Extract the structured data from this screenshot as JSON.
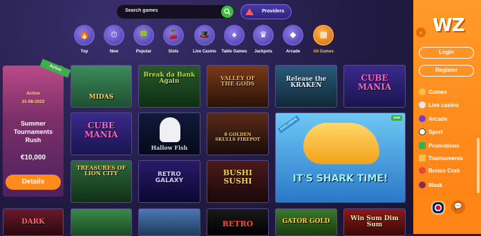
{
  "search": {
    "placeholder": "Search games"
  },
  "providers": {
    "label": "Providers"
  },
  "categories": [
    {
      "label": "Top",
      "icon": "flame-icon"
    },
    {
      "label": "New",
      "icon": "new-icon"
    },
    {
      "label": "Popular",
      "icon": "clover-icon"
    },
    {
      "label": "Slots",
      "icon": "cherry-icon"
    },
    {
      "label": "Live Casino",
      "icon": "dealer-icon"
    },
    {
      "label": "Table Games",
      "icon": "cards-icon"
    },
    {
      "label": "Jackpots",
      "icon": "crown-icon"
    },
    {
      "label": "Arcade",
      "icon": "gem-icon"
    },
    {
      "label": "All Games",
      "icon": "grid-icon"
    }
  ],
  "promo": {
    "ribbon": "Active",
    "status": "Active",
    "date": "31-08-2022",
    "title": "Summer Tournaments Rush",
    "prize": "€10,000",
    "button": "Details"
  },
  "games": [
    {
      "title": "MIDAS"
    },
    {
      "title": "Break da Bank Again"
    },
    {
      "title": "VALLEY OF THE GODS"
    },
    {
      "title": "Release the KRAKEN"
    },
    {
      "title": "CUBE MANIA"
    },
    {
      "title": "CUBE MANIA"
    },
    {
      "title": "Hallow Fish"
    },
    {
      "title": "8 GOLDEN SKULLS FIREPOT"
    },
    {
      "title": "TREASURES OF LION CITY"
    },
    {
      "title": "RETRO GALAXY"
    },
    {
      "title": "BUSHI SUSHI"
    },
    {
      "title": "IT'S SHARK TIME!"
    },
    {
      "title": "DARK"
    },
    {
      "title": ""
    },
    {
      "title": ""
    },
    {
      "title": "RETRO"
    },
    {
      "title": "GATOR GOLD"
    },
    {
      "title": "Win Sum Dim Sum"
    }
  ],
  "badges": {
    "new": "new",
    "exclusive": "EXCLUSIVE"
  },
  "panel": {
    "logo": "WZ",
    "login": "Login",
    "register": "Register",
    "menu": [
      {
        "label": "Games"
      },
      {
        "label": "Live casino"
      },
      {
        "label": "Arcade"
      },
      {
        "label": "Sport"
      },
      {
        "label": "Promotions"
      },
      {
        "label": "Tournaments"
      },
      {
        "label": "Bonus Crab"
      },
      {
        "label": "Mask"
      }
    ]
  },
  "colors": {
    "accent": "#ff8a1e",
    "background": "#221c45",
    "search_button": "#3bbd3f"
  }
}
